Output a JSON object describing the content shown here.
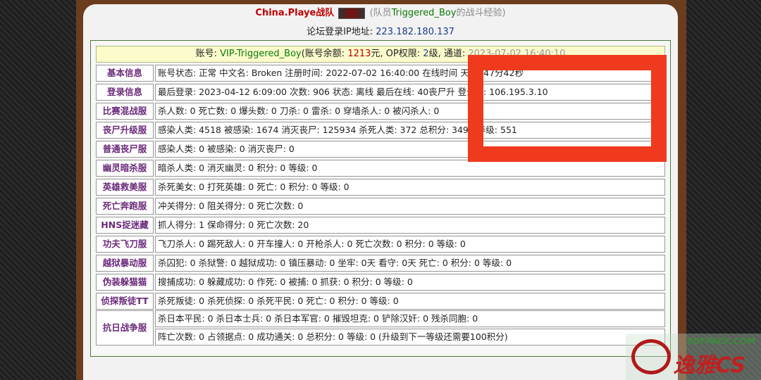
{
  "header": {
    "team_name": "China.Playe战队",
    "subtitle_pre": "(队员",
    "player": "Triggered_Boy",
    "subtitle_post": "的战斗经验)"
  },
  "login_ip_line": {
    "label": "论坛登录IP地址:",
    "ip": "223.182.180.137"
  },
  "account_line": {
    "p1": "账号: ",
    "account": "VIP-Triggered_Boy",
    "p2": "(账号余额: ",
    "balance": "1213",
    "p3": "元, OP权限: ",
    "op": "2",
    "p4": "级, 通道: ",
    "channel": "2023-07-02 16:40:10"
  },
  "rows": [
    {
      "label": "基本信息",
      "text": "账号状态: 正常 中文名: Broken 注册时间: 2022-07-02 16:40:00 在线时间 天8时47分42秒"
    },
    {
      "label": "登录信息",
      "text": "最后登录: 2023-04-12 6:09:00 次数: 906 状态: 离线 最后在线: 40丧尸升 登录IP: 106.195.3.10"
    },
    {
      "label": "比赛混战服",
      "text": "杀人数: 0 死亡数: 0 爆头数: 0 刀杀: 0 雷杀: 0 穿墙杀人: 0 被闪杀人: 0"
    },
    {
      "label": "丧尸升级服",
      "text": "感染人类: 4518 被感染: 1674 消灭丧尸: 125934 杀死人类: 372 总积分: 3492 等级: 551"
    },
    {
      "label": "普通丧尸服",
      "text": "感染人类: 0 被感染: 0 消灭丧尸: 0"
    },
    {
      "label": "幽灵暗杀服",
      "text": "暗杀人类: 0 消灭幽灵: 0 积分: 0 等级: 0"
    },
    {
      "label": "英雄救美服",
      "text": "杀死美女: 0 打死英雄: 0 死亡: 0 积分: 0 等级: 0"
    },
    {
      "label": "死亡奔跑服",
      "text": "冲关得分: 0 阻关得分: 0 死亡次数: 0"
    },
    {
      "label": "HNS捉迷藏",
      "text": "抓人得分: 1 保命得分: 0 死亡次数: 20"
    },
    {
      "label": "功夫飞刀服",
      "text": "飞刀杀人: 0 踢死敌人: 0 开车撞人: 0 开枪杀人: 0 死亡次数: 0 积分: 0 等级: 0"
    },
    {
      "label": "越狱暴动服",
      "text": "杀囚犯: 0 杀狱警: 0 越狱成功: 0 镇压暴动: 0 坐牢: 0天 看守: 0天 死亡: 0 积分: 0 等级: 0"
    },
    {
      "label": "伪装躲猫猫",
      "text": "搜捕成功: 0 躲藏成功: 0 作死: 0 被捕: 0 抓获: 0 积分: 0 等级: 0"
    },
    {
      "label": "侦探叛徒TT",
      "text": "杀死叛徒: 0 杀死侦探: 0 杀死平民: 0 死亡: 0 积分: 0 等级: 0"
    }
  ],
  "war_row": {
    "label": "抗日战争服",
    "line1": "杀日本平民: 0 杀日本士兵: 0 杀日本军官: 0 摧毁坦克: 0 铲除汉奸: 0 残杀同胞: 0",
    "line2": "阵亡次数: 0 占领据点: 0 成功通关: 0 总积分: 0 等级: 0 (升级到下一等级还需要100积分)"
  },
  "overlay": {
    "ip_label": "登录IP:",
    "ip": "106.195.3.10",
    "score": "3492",
    "level_label": "等级:",
    "level": "551"
  },
  "watermark": {
    "site": "SOFPACK.COM",
    "brand": "逸雅CS"
  },
  "colors": {
    "frame": "#6b3d1f",
    "label_purple": "#6a2a7a",
    "highlight_red": "#f03a1e",
    "account_bg": "#fbfbcc"
  }
}
